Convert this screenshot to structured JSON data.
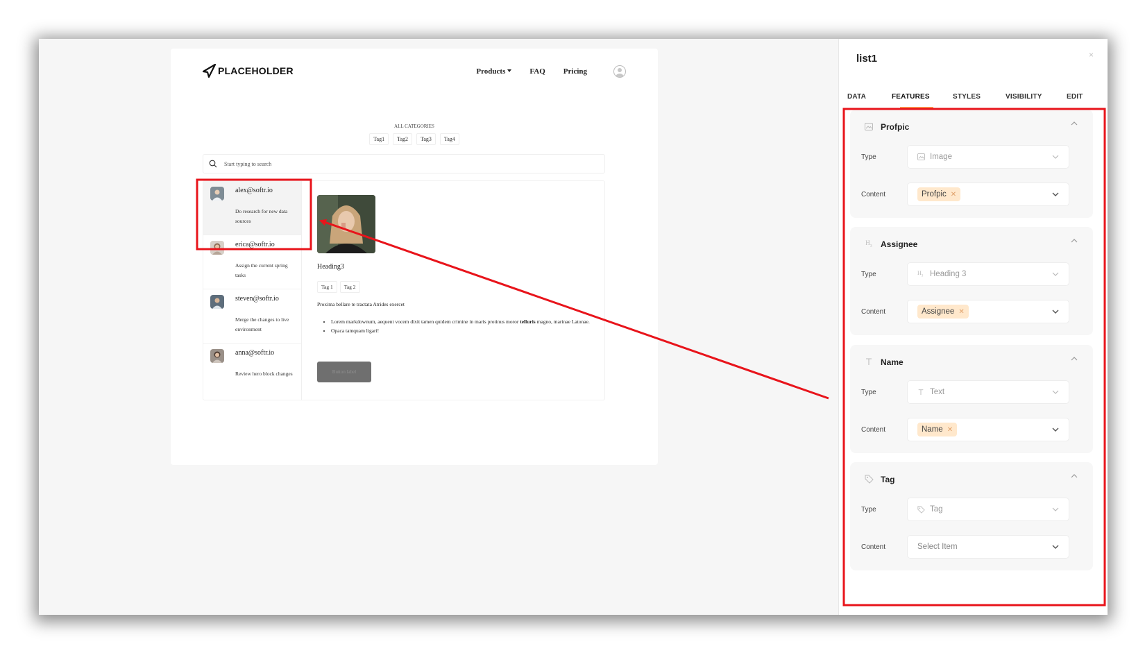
{
  "preview": {
    "logo_text": "PLACEHOLDER",
    "nav": {
      "products": "Products",
      "faq": "FAQ",
      "pricing": "Pricing"
    },
    "categories_title": "ALL CATEGORIES",
    "category_tags": [
      "Tag1",
      "Tag2",
      "Tag3",
      "Tag4"
    ],
    "search_placeholder": "Start typing to search",
    "list_items": [
      {
        "name": "alex@softr.io",
        "desc": "Do research for new data sources"
      },
      {
        "name": "erica@softr.io",
        "desc": "Assign the current spring tasks"
      },
      {
        "name": "steven@softr.io",
        "desc": "Merge the changes to live environment"
      },
      {
        "name": "anna@softr.io",
        "desc": "Review hero block changes"
      }
    ],
    "detail": {
      "heading": "Heading3",
      "tags": [
        "Tag 1",
        "Tag 2"
      ],
      "paragraph": "Proxima bellare te tractata Atrides exercet",
      "bullets": [
        {
          "text": "Lorem markdownum, aequent vocem dixit tamen quidem crimine in maris protinus moror ",
          "bold": "telluris",
          "tail": " magno, marinae Latonae."
        },
        {
          "text": "Opaca tamquam ligari!",
          "bold": "",
          "tail": ""
        }
      ],
      "button_label": "Button label"
    }
  },
  "panel": {
    "title": "list1",
    "close": "×",
    "tabs": [
      "DATA",
      "FEATURES",
      "STYLES",
      "VISIBILITY",
      "EDIT"
    ],
    "active_tab": "FEATURES",
    "accent_color": "#ff9d4d",
    "highlight_color": "#e8141b",
    "labels": {
      "type": "Type",
      "content": "Content"
    },
    "sections": [
      {
        "title": "Profpic",
        "icon": "image-icon",
        "type_value": "Image",
        "type_icon": "image-icon",
        "content_chip": "Profpic",
        "content_placeholder": ""
      },
      {
        "title": "Assignee",
        "icon": "heading-icon",
        "type_value": "Heading 3",
        "type_icon": "heading-icon",
        "content_chip": "Assignee",
        "content_placeholder": ""
      },
      {
        "title": "Name",
        "icon": "text-icon",
        "type_value": "Text",
        "type_icon": "text-icon",
        "content_chip": "Name",
        "content_placeholder": ""
      },
      {
        "title": "Tag",
        "icon": "tag-icon",
        "type_value": "Tag",
        "type_icon": "tag-icon",
        "content_chip": "",
        "content_placeholder": "Select Item"
      }
    ]
  }
}
